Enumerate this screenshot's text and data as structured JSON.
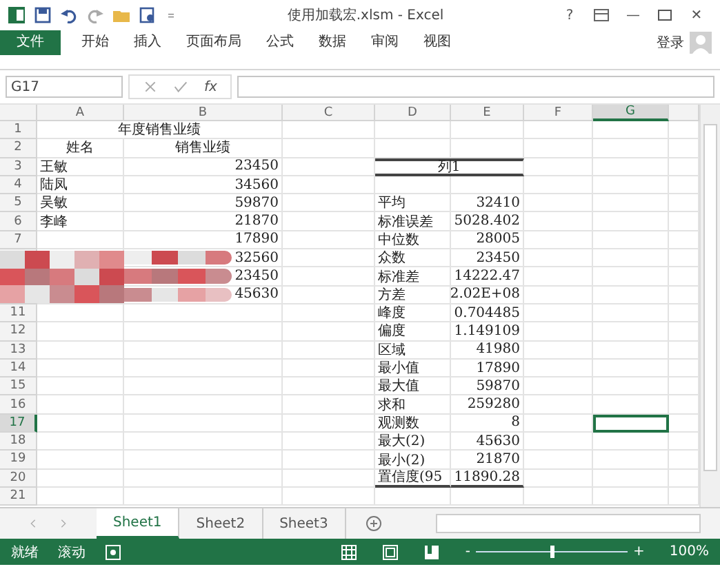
{
  "title_bar": {
    "title": "使用加载宏.xlsm - Excel",
    "help": "?",
    "minimize": "—",
    "close": "✕"
  },
  "ribbon": {
    "tabs": [
      {
        "label": "文件",
        "kind": "file",
        "selected": false
      },
      {
        "label": "开始",
        "kind": "tab",
        "selected": false
      },
      {
        "label": "插入",
        "kind": "tab",
        "selected": false
      },
      {
        "label": "页面布局",
        "kind": "tab",
        "selected": false
      },
      {
        "label": "公式",
        "kind": "tab",
        "selected": false
      },
      {
        "label": "数据",
        "kind": "tab",
        "selected": false
      },
      {
        "label": "审阅",
        "kind": "tab",
        "selected": false
      },
      {
        "label": "视图",
        "kind": "tab",
        "selected": false
      }
    ],
    "sign_in": "登录"
  },
  "formula_bar": {
    "name_box": "G17",
    "fx": "fx"
  },
  "columns": [
    {
      "label": "A",
      "selected": false
    },
    {
      "label": "B",
      "selected": false
    },
    {
      "label": "C",
      "selected": false
    },
    {
      "label": "D",
      "selected": false
    },
    {
      "label": "E",
      "selected": false
    },
    {
      "label": "F",
      "selected": false
    },
    {
      "label": "G",
      "selected": true
    }
  ],
  "rows": [
    {
      "number": "1",
      "selected": false,
      "title": "年度销售业绩"
    },
    {
      "number": "2",
      "selected": false,
      "name_header": "姓名",
      "sales_header": "销售业绩"
    },
    {
      "number": "3",
      "selected": false,
      "name": "王敏",
      "sales": "23450",
      "stat_header": "列1"
    },
    {
      "number": "4",
      "selected": false,
      "name": "陆凤",
      "sales": "34560"
    },
    {
      "number": "5",
      "selected": false,
      "name": "吴敏",
      "sales": "59870",
      "stat": "平均",
      "value": "32410"
    },
    {
      "number": "6",
      "selected": false,
      "name": "李峰",
      "sales": "21870",
      "stat": "标准误差",
      "value": "5028.402"
    },
    {
      "number": "7",
      "selected": false,
      "sales": "17890",
      "stat": "中位数",
      "value": "28005"
    },
    {
      "sales": "32560",
      "stat": "众数",
      "value": "23450"
    },
    {
      "sales": "23450",
      "stat": "标准差",
      "value": "14222.47"
    },
    {
      "sales": "45630",
      "stat": "方差",
      "value": "2.02E+08"
    },
    {
      "number": "11",
      "selected": false,
      "stat": "峰度",
      "value": "0.704485"
    },
    {
      "number": "12",
      "selected": false,
      "stat": "偏度",
      "value": "1.149109"
    },
    {
      "number": "13",
      "selected": false,
      "stat": "区域",
      "value": "41980"
    },
    {
      "number": "14",
      "selected": false,
      "stat": "最小值",
      "value": "17890"
    },
    {
      "number": "15",
      "selected": false,
      "stat": "最大值",
      "value": "59870"
    },
    {
      "number": "16",
      "selected": false,
      "stat": "求和",
      "value": "259280"
    },
    {
      "number": "17",
      "selected": true,
      "stat": "观测数",
      "value": "8"
    },
    {
      "number": "18",
      "selected": false,
      "stat": "最大(2)",
      "value": "45630"
    },
    {
      "number": "19",
      "selected": false,
      "stat": "最小(2)",
      "value": "21870"
    },
    {
      "number": "20",
      "selected": false,
      "stat": "置信度(95",
      "value": "11890.28",
      "closing_rule": true
    },
    {
      "number": "21",
      "selected": false
    }
  ],
  "sheet_tabs": [
    {
      "label": "Sheet1",
      "selected": true
    },
    {
      "label": "Sheet2",
      "selected": false
    },
    {
      "label": "Sheet3",
      "selected": false
    }
  ],
  "status_bar": {
    "items": [
      "就绪",
      "滚动"
    ],
    "zoom_out": "-",
    "zoom": {
      "level": 0.5
    },
    "zoom_in": "+",
    "zoom_text": "100%"
  }
}
